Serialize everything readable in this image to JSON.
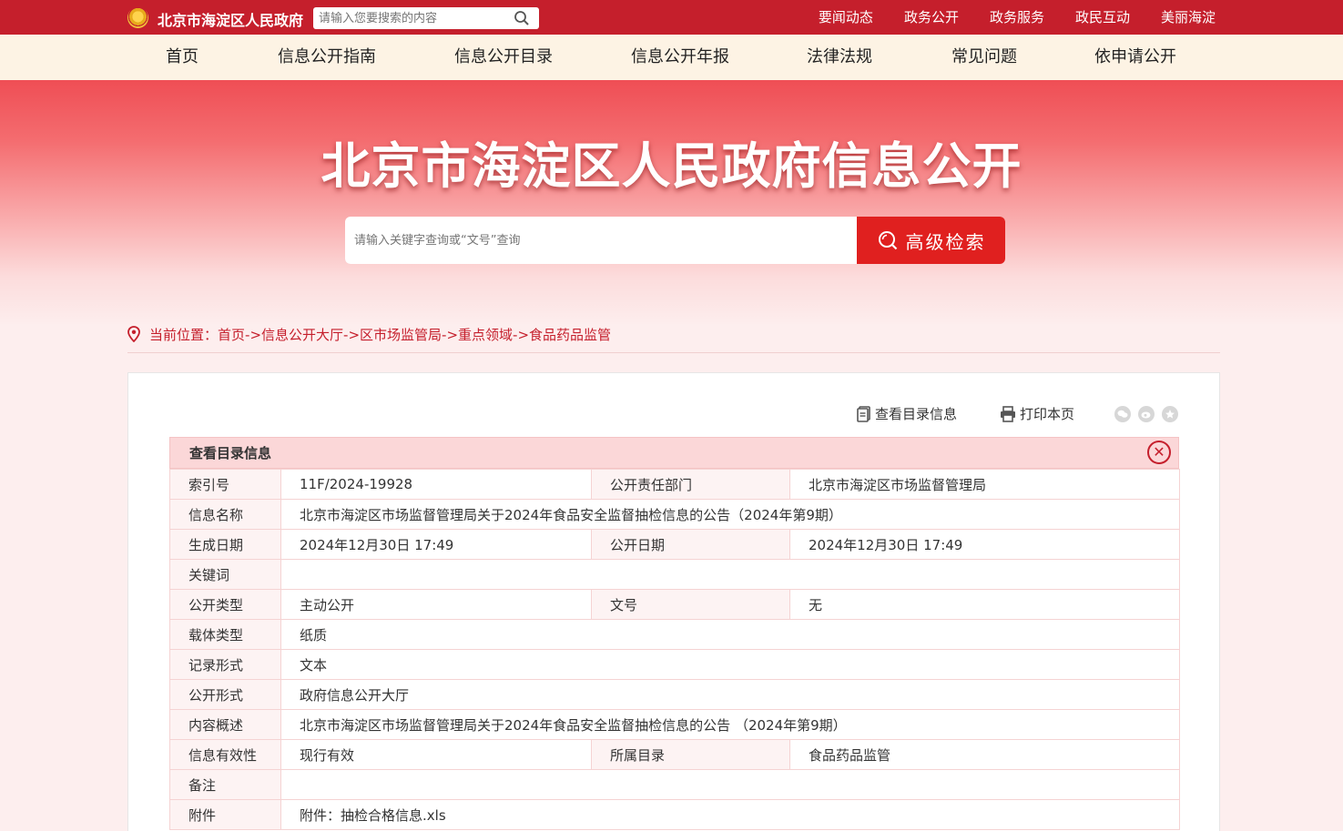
{
  "header": {
    "site_name": "北京市海淀区人民政府",
    "search_placeholder": "请输入您要搜索的内容",
    "links": [
      "要闻动态",
      "政务公开",
      "政务服务",
      "政民互动",
      "美丽海淀"
    ]
  },
  "nav": [
    "首页",
    "信息公开指南",
    "信息公开目录",
    "信息公开年报",
    "法律法规",
    "常见问题",
    "依申请公开"
  ],
  "banner": {
    "title": "北京市海淀区人民政府信息公开",
    "search_placeholder": "请输入关键字查询或“文号”查询",
    "advanced_button": "高级检索"
  },
  "breadcrumb": {
    "prefix": "当前位置：",
    "items": [
      "首页",
      "信息公开大厅",
      "区市场监管局",
      "重点领域",
      "食品药品监管"
    ],
    "separator": "->"
  },
  "tools": {
    "view_catalog": "查看目录信息",
    "print": "打印本页"
  },
  "info": {
    "title": "查看目录信息",
    "rows": {
      "index_label": "索引号",
      "index_value": "11F/2024-19928",
      "dept_label": "公开责任部门",
      "dept_value": "北京市海淀区市场监督管理局",
      "name_label": "信息名称",
      "name_value": "北京市海淀区市场监督管理局关于2024年食品安全监督抽检信息的公告（2024年第9期）",
      "gen_date_label": "生成日期",
      "gen_date_value": "2024年12月30日 17:49",
      "pub_date_label": "公开日期",
      "pub_date_value": "2024年12月30日 17:49",
      "keywords_label": "关键词",
      "keywords_value": "",
      "pub_type_label": "公开类型",
      "pub_type_value": "主动公开",
      "doc_no_label": "文号",
      "doc_no_value": "无",
      "carrier_label": "载体类型",
      "carrier_value": "纸质",
      "record_label": "记录形式",
      "record_value": "文本",
      "pub_form_label": "公开形式",
      "pub_form_value": "政府信息公开大厅",
      "summary_label": "内容概述",
      "summary_value": "北京市海淀区市场监督管理局关于2024年食品安全监督抽检信息的公告 （2024年第9期）",
      "validity_label": "信息有效性",
      "validity_value": "现行有效",
      "catalog_label": "所属目录",
      "catalog_value": "食品药品监管",
      "remark_label": "备注",
      "remark_value": "",
      "attach_label": "附件",
      "attach_value": "附件：抽检合格信息.xls"
    }
  }
}
